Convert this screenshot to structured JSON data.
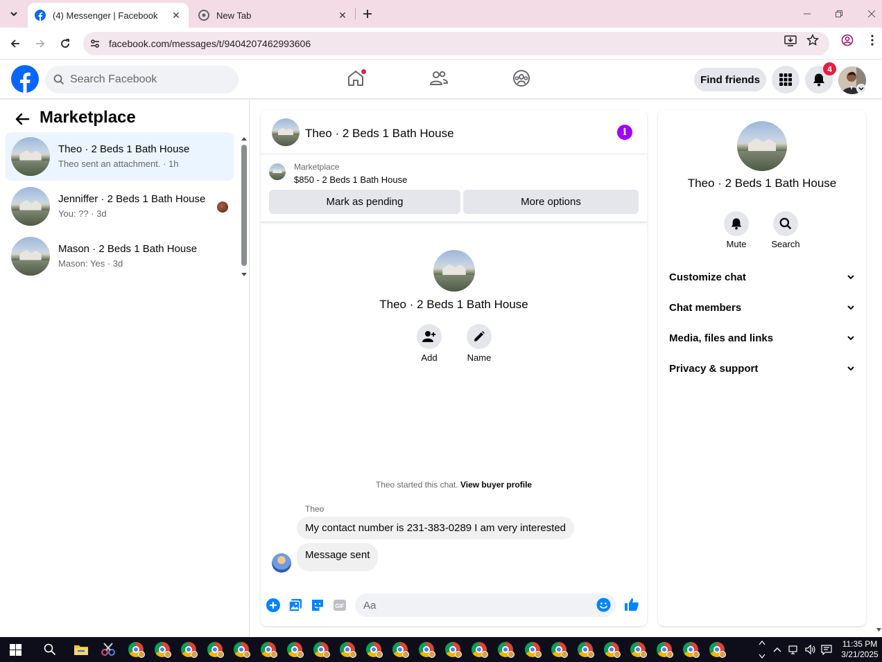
{
  "browser": {
    "tabs": [
      {
        "title": "(4) Messenger | Facebook",
        "active": true
      },
      {
        "title": "New Tab",
        "active": false
      }
    ],
    "url": "facebook.com/messages/t/9404207462993606"
  },
  "fb_header": {
    "search_placeholder": "Search Facebook",
    "find_friends": "Find friends",
    "notification_count": "4"
  },
  "left_panel": {
    "title": "Marketplace",
    "conversations": [
      {
        "name": "Theo · 2 Beds 1 Bath House",
        "preview": "Theo sent an attachment. · 1h",
        "active": true
      },
      {
        "name": "Jenniffer · 2 Beds 1 Bath House",
        "preview": "You: ?? · 3d",
        "active": false
      },
      {
        "name": "Mason · 2 Beds 1 Bath House",
        "preview": "Mason: Yes · 3d",
        "active": false
      }
    ]
  },
  "chat": {
    "title": "Theo · 2 Beds 1 Bath House",
    "marketplace_label": "Marketplace",
    "listing": "$850 - 2 Beds 1 Bath House",
    "mark_pending": "Mark as pending",
    "more_options": "More options",
    "intro_name": "Theo · 2 Beds 1 Bath House",
    "add_label": "Add",
    "name_label": "Name",
    "started_text": "Theo started this chat.",
    "view_profile": "View buyer profile",
    "sender": "Theo",
    "messages": [
      "My contact number is 231-383-0289 I am very interested",
      "Message sent"
    ],
    "composer_placeholder": "Aa"
  },
  "right_panel": {
    "name": "Theo · 2 Beds 1 Bath House",
    "mute": "Mute",
    "search": "Search",
    "sections": [
      "Customize chat",
      "Chat members",
      "Media, files and links",
      "Privacy & support"
    ]
  },
  "taskbar": {
    "time": "11:35 PM",
    "date": "3/21/2025"
  },
  "colors": {
    "fb_blue": "#0866ff",
    "messenger_purple": "#a100ff",
    "active_conv_bg": "#ebf5ff",
    "notification_red": "#e41e3f"
  }
}
